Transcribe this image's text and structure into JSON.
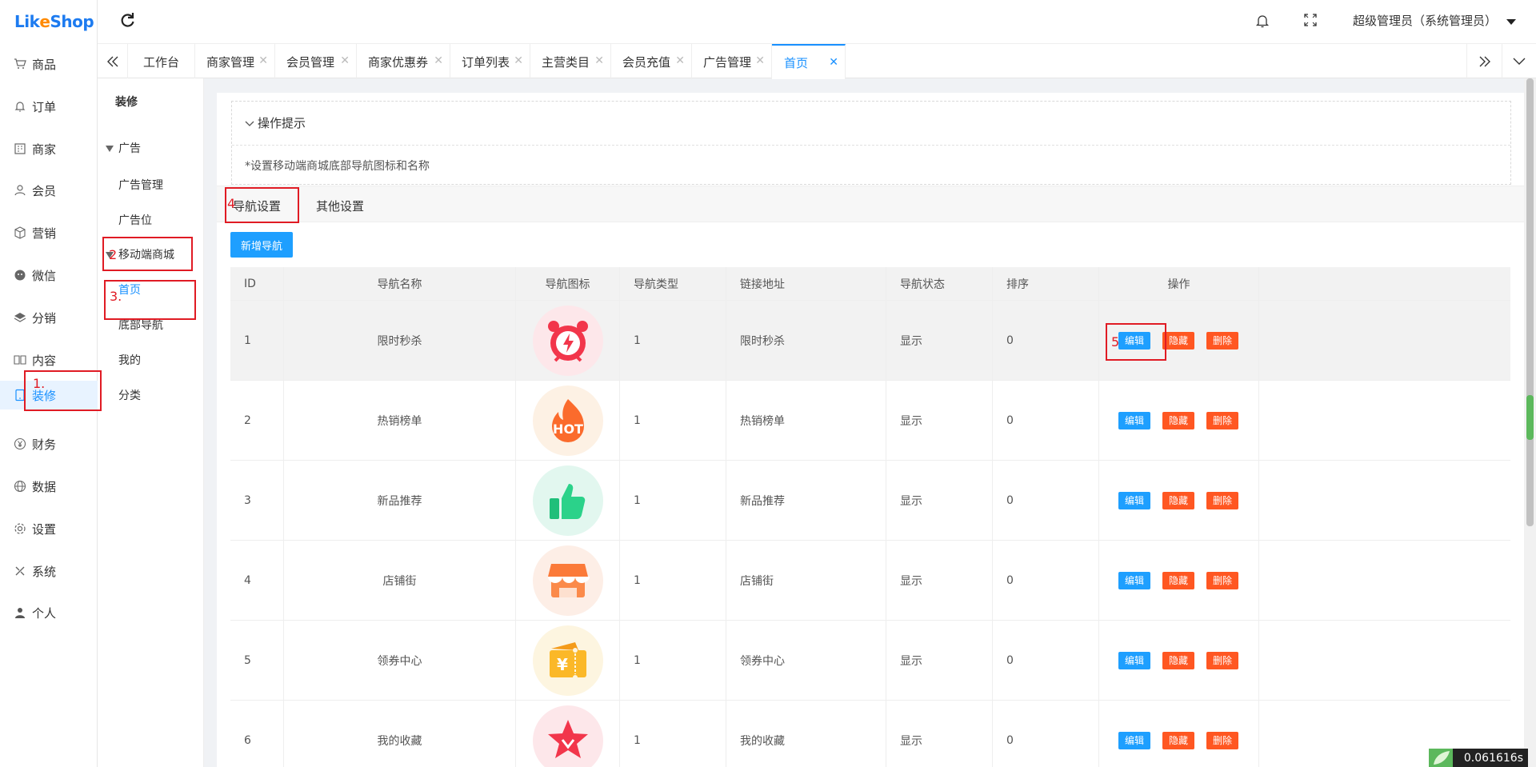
{
  "app": {
    "logo_a": "Lik",
    "logo_b": "e",
    "logo_c": "Shop"
  },
  "sidebar": {
    "items": [
      {
        "label": "商品",
        "icon": "cart-icon"
      },
      {
        "label": "订单",
        "icon": "bell-icon"
      },
      {
        "label": "商家",
        "icon": "store-icon"
      },
      {
        "label": "会员",
        "icon": "user-icon"
      },
      {
        "label": "营销",
        "icon": "box-icon"
      },
      {
        "label": "微信",
        "icon": "wechat-icon"
      },
      {
        "label": "分销",
        "icon": "layers-icon"
      },
      {
        "label": "内容",
        "icon": "book-icon"
      },
      {
        "label": "装修",
        "icon": "tablet-icon"
      },
      {
        "label": "财务",
        "icon": "yen-icon"
      },
      {
        "label": "数据",
        "icon": "globe-icon"
      },
      {
        "label": "设置",
        "icon": "gear-icon"
      },
      {
        "label": "系统",
        "icon": "tools-icon"
      },
      {
        "label": "个人",
        "icon": "person-icon"
      }
    ]
  },
  "header": {
    "user": "超级管理员（系统管理员）"
  },
  "tabs": [
    {
      "label": "工作台"
    },
    {
      "label": "商家管理"
    },
    {
      "label": "会员管理"
    },
    {
      "label": "商家优惠券"
    },
    {
      "label": "订单列表"
    },
    {
      "label": "主营类目"
    },
    {
      "label": "会员充值"
    },
    {
      "label": "广告管理"
    },
    {
      "label": "首页"
    }
  ],
  "subnav": {
    "title": "装修",
    "group_ad": "广告",
    "ad_manage": "广告管理",
    "ad_position": "广告位",
    "group_mobile": "移动端商城",
    "home": "首页",
    "bottom_nav": "底部导航",
    "mine": "我的",
    "category": "分类"
  },
  "tips": {
    "title": "操作提示",
    "text": "*设置移动端商城底部导航图标和名称"
  },
  "content_tabs": {
    "nav_settings": "导航设置",
    "other_settings": "其他设置"
  },
  "add_button": "新增导航",
  "table": {
    "headers": [
      "ID",
      "导航名称",
      "导航图标",
      "导航类型",
      "链接地址",
      "导航状态",
      "排序",
      "操作"
    ],
    "rows": [
      {
        "id": "1",
        "name": "限时秒杀",
        "icon": "alarm-clock-icon",
        "type": "1",
        "link": "限时秒杀",
        "status": "显示",
        "sort": "0"
      },
      {
        "id": "2",
        "name": "热销榜单",
        "icon": "hot-flame-icon",
        "type": "1",
        "link": "热销榜单",
        "status": "显示",
        "sort": "0"
      },
      {
        "id": "3",
        "name": "新品推荐",
        "icon": "thumbs-up-icon",
        "type": "1",
        "link": "新品推荐",
        "status": "显示",
        "sort": "0"
      },
      {
        "id": "4",
        "name": "店铺街",
        "icon": "shop-icon",
        "type": "1",
        "link": "店铺街",
        "status": "显示",
        "sort": "0"
      },
      {
        "id": "5",
        "name": "领券中心",
        "icon": "coupon-icon",
        "type": "1",
        "link": "领券中心",
        "status": "显示",
        "sort": "0"
      },
      {
        "id": "6",
        "name": "我的收藏",
        "icon": "star-icon",
        "type": "1",
        "link": "我的收藏",
        "status": "显示",
        "sort": "0"
      }
    ],
    "actions": {
      "edit": "编辑",
      "hide": "隐藏",
      "delete": "删除"
    }
  },
  "annotations": [
    "1.",
    "2",
    "3.",
    "4",
    "5"
  ],
  "timer": "0.061616s",
  "colors": {
    "primary": "#1e9fff",
    "danger": "#ff5722",
    "annotation": "#e01b24"
  }
}
